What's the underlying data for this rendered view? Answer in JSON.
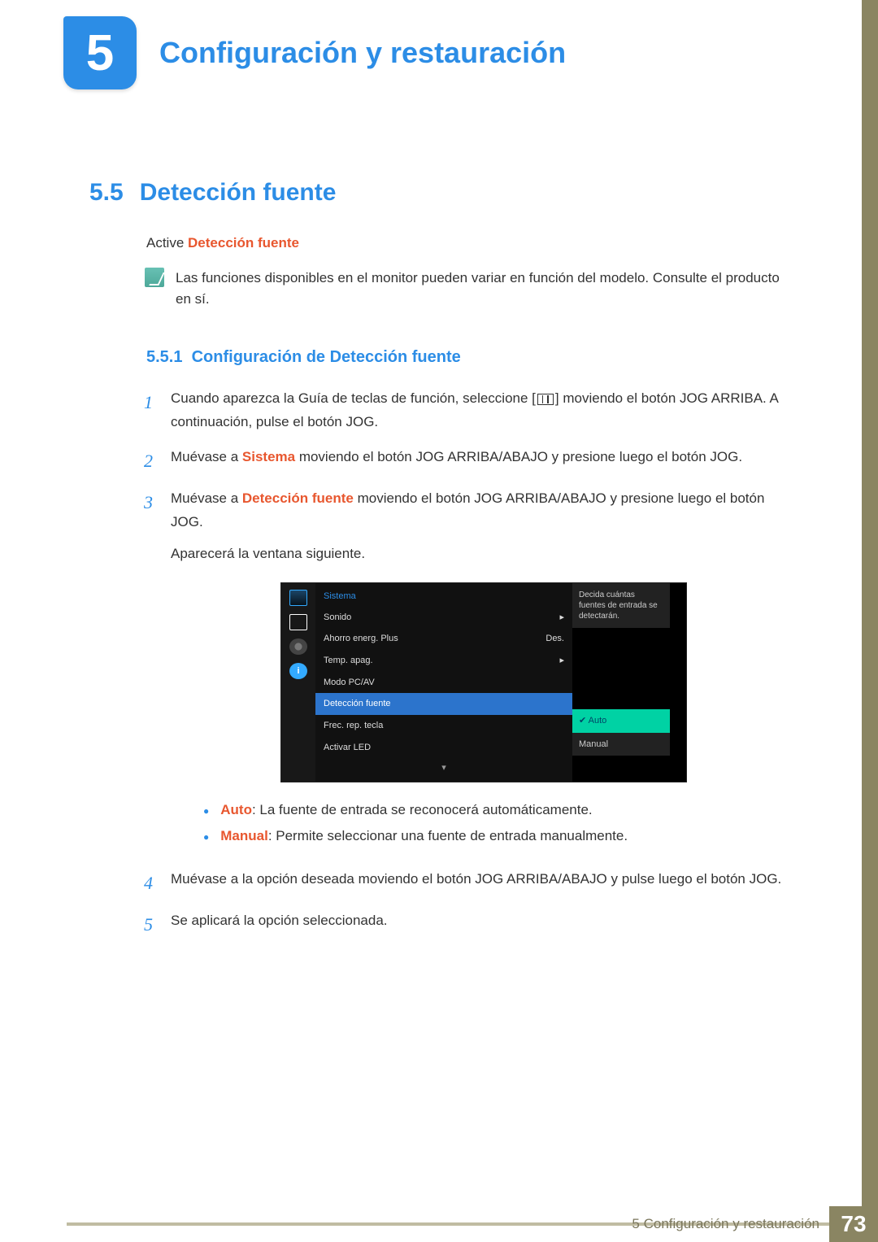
{
  "chapter": {
    "number": "5",
    "title": "Configuración y restauración"
  },
  "section": {
    "number": "5.5",
    "title": "Detección fuente"
  },
  "intro": {
    "prefix": "Active ",
    "hl": "Detección fuente"
  },
  "note": "Las funciones disponibles en el monitor pueden variar en función del modelo. Consulte el producto en sí.",
  "subsection": {
    "number": "5.5.1",
    "title": "Configuración de Detección fuente"
  },
  "steps": {
    "s1a": "Cuando aparezca la Guía de teclas de función, seleccione [",
    "s1b": "] moviendo el botón JOG ARRIBA. A continuación, pulse el botón JOG.",
    "s2a": "Muévase a ",
    "s2hl": "Sistema",
    "s2b": " moviendo el botón JOG ARRIBA/ABAJO y presione luego el botón JOG.",
    "s3a": "Muévase a ",
    "s3hl": "Detección fuente",
    "s3b": " moviendo el botón JOG ARRIBA/ABAJO y presione luego el botón JOG.",
    "s3c": "Aparecerá la ventana siguiente.",
    "s4": "Muévase a la opción deseada moviendo el botón JOG ARRIBA/ABAJO y pulse luego el botón JOG.",
    "s5": "Se aplicará la opción seleccionada."
  },
  "osd": {
    "category": "Sistema",
    "items": {
      "sonido": "Sonido",
      "ahorro": "Ahorro energ. Plus",
      "ahorro_val": "Des.",
      "temp": "Temp. apag.",
      "modo": "Modo PC/AV",
      "deteccion": "Detección fuente",
      "frec": "Frec. rep. tecla",
      "led": "Activar LED"
    },
    "sub": {
      "auto": "Auto",
      "manual": "Manual"
    },
    "hint": "Decida cuántas fuentes de entrada se detectarán.",
    "arrow_right": "▸",
    "arrow_down": "▾",
    "info_i": "i"
  },
  "bullets": {
    "auto_label": "Auto",
    "auto_text": ": La fuente de entrada se reconocerá automáticamente.",
    "manual_label": "Manual",
    "manual_text": ": Permite seleccionar una fuente de entrada manualmente."
  },
  "nums": {
    "n1": "1",
    "n2": "2",
    "n3": "3",
    "n4": "4",
    "n5": "5"
  },
  "footer": {
    "text": "5 Configuración y restauración",
    "page": "73"
  }
}
